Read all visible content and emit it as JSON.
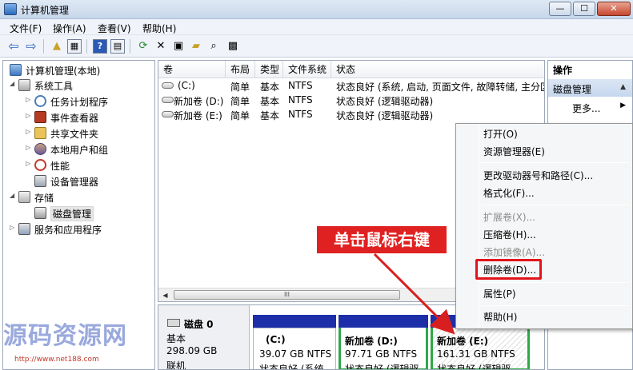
{
  "window": {
    "title": "计算机管理"
  },
  "menu": [
    "文件(F)",
    "操作(A)",
    "查看(V)",
    "帮助(H)"
  ],
  "toolbar": {
    "icons": [
      "back-arrow",
      "forward-arrow",
      "up-folder",
      "show-hide-tree",
      "help",
      "console-tree",
      "refresh",
      "delete",
      "properties",
      "open",
      "search",
      "disk-properties"
    ],
    "glyphs": {
      "back": "⇦",
      "forward": "⇨",
      "help": "?",
      "refresh": "⟳",
      "delete": "✕"
    }
  },
  "tree": {
    "root": "计算机管理(本地)",
    "system_tools": "系统工具",
    "task_scheduler": "任务计划程序",
    "event_viewer": "事件查看器",
    "shared_folders": "共享文件夹",
    "local_users": "本地用户和组",
    "performance": "性能",
    "device_manager": "设备管理器",
    "storage": "存储",
    "disk_management": "磁盘管理",
    "services_apps": "服务和应用程序"
  },
  "volumes": {
    "headers": [
      "卷",
      "布局",
      "类型",
      "文件系统",
      "状态"
    ],
    "rows": [
      {
        "name": "(C:)",
        "layout": "简单",
        "type": "基本",
        "fs": "NTFS",
        "status": "状态良好 (系统, 启动, 页面文件, 故障转储, 主分区"
      },
      {
        "name": "新加卷 (D:)",
        "layout": "简单",
        "type": "基本",
        "fs": "NTFS",
        "status": "状态良好 (逻辑驱动器)"
      },
      {
        "name": "新加卷 (E:)",
        "layout": "简单",
        "type": "基本",
        "fs": "NTFS",
        "status": "状态良好 (逻辑驱动器)"
      }
    ],
    "scroll_thumb": "III"
  },
  "disk": {
    "name": "磁盘 0",
    "kind": "基本",
    "size": "298.09 GB",
    "state": "联机",
    "partitions": [
      {
        "name": "(C:)",
        "size": "39.07 GB NTFS",
        "status": "状态良好 (系统"
      },
      {
        "name": "新加卷 (D:)",
        "size": "97.71 GB NTFS",
        "status": "状态良好 (逻辑驱"
      },
      {
        "name": "新加卷 (E:)",
        "size": "161.31 GB NTFS",
        "status": "状态良好 (逻辑驱"
      }
    ]
  },
  "actions": {
    "header": "操作",
    "section": "磁盘管理",
    "more": "更多..."
  },
  "context_menu": {
    "open": "打开(O)",
    "explorer": "资源管理器(E)",
    "change_letter": "更改驱动器号和路径(C)...",
    "format": "格式化(F)...",
    "extend": "扩展卷(X)...",
    "shrink": "压缩卷(H)...",
    "mirror": "添加镜像(A)...",
    "delete": "删除卷(D)...",
    "properties": "属性(P)",
    "help": "帮助(H)"
  },
  "annotation": {
    "text": "单击鼠标右键",
    "color": "#e02121"
  },
  "watermark": {
    "main": "源码资源网",
    "url": "http://www.net188.com"
  },
  "colors": {
    "partition_bar": "#1d2fa8",
    "selected_border": "#2ea84a",
    "highlight": "#e2141b"
  }
}
